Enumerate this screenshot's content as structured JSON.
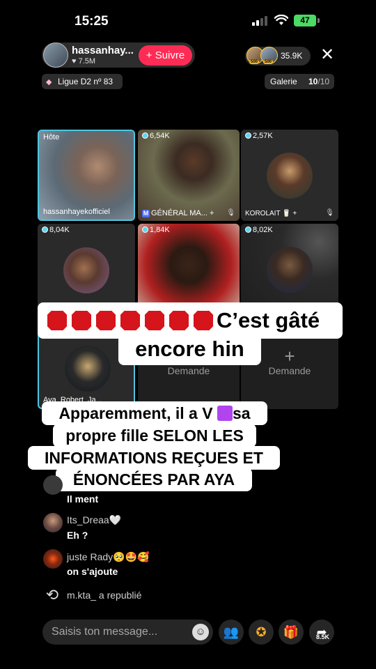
{
  "status_bar": {
    "time": "15:25",
    "battery": "47"
  },
  "host": {
    "name": "hassanhay...",
    "likes": "7.5M",
    "follow_label": "Suivre"
  },
  "viewers": {
    "count": "35.9K",
    "badge_1": "500",
    "badge_2": "500"
  },
  "league": "Ligue D2 nº 83",
  "gallery": {
    "label": "Galerie",
    "current": "10",
    "total": "/10"
  },
  "tiles": [
    {
      "top": "Hôte",
      "bottom": "hassanhayekofficiel"
    },
    {
      "top": "6,54K",
      "bottom": "GÉNÉRAL MA...",
      "badge": "M"
    },
    {
      "top": "2,57K",
      "bottom": "KOROLAIT 🥛"
    },
    {
      "top": "8,04K"
    },
    {
      "top": "1,84K"
    },
    {
      "top": "8,02K"
    },
    {
      "bottom": "Aya_Robert_Ja..."
    },
    {
      "demande": "Demande"
    },
    {
      "demande": "Demande"
    }
  ],
  "caption": {
    "line1": "C’est gâté",
    "line2": "encore hin",
    "line3_a": "Apparemment, il a V ",
    "line3_b": "sa",
    "line4": "propre fille SELON LES",
    "line5": "INFORMATIONS REÇUES ET",
    "line6": "ÉNONCÉES PAR AYA"
  },
  "comments": [
    {
      "user": "",
      "text": "Il ment"
    },
    {
      "user": "Its_Dreaa🤍",
      "text": "Eh ?"
    },
    {
      "user": "juste Rady🥺🤩🥰",
      "text": "on s'ajoute"
    }
  ],
  "repost": "m.kta_ a republié",
  "input": {
    "placeholder": "Saisis ton message..."
  },
  "share_count": "8.5K"
}
